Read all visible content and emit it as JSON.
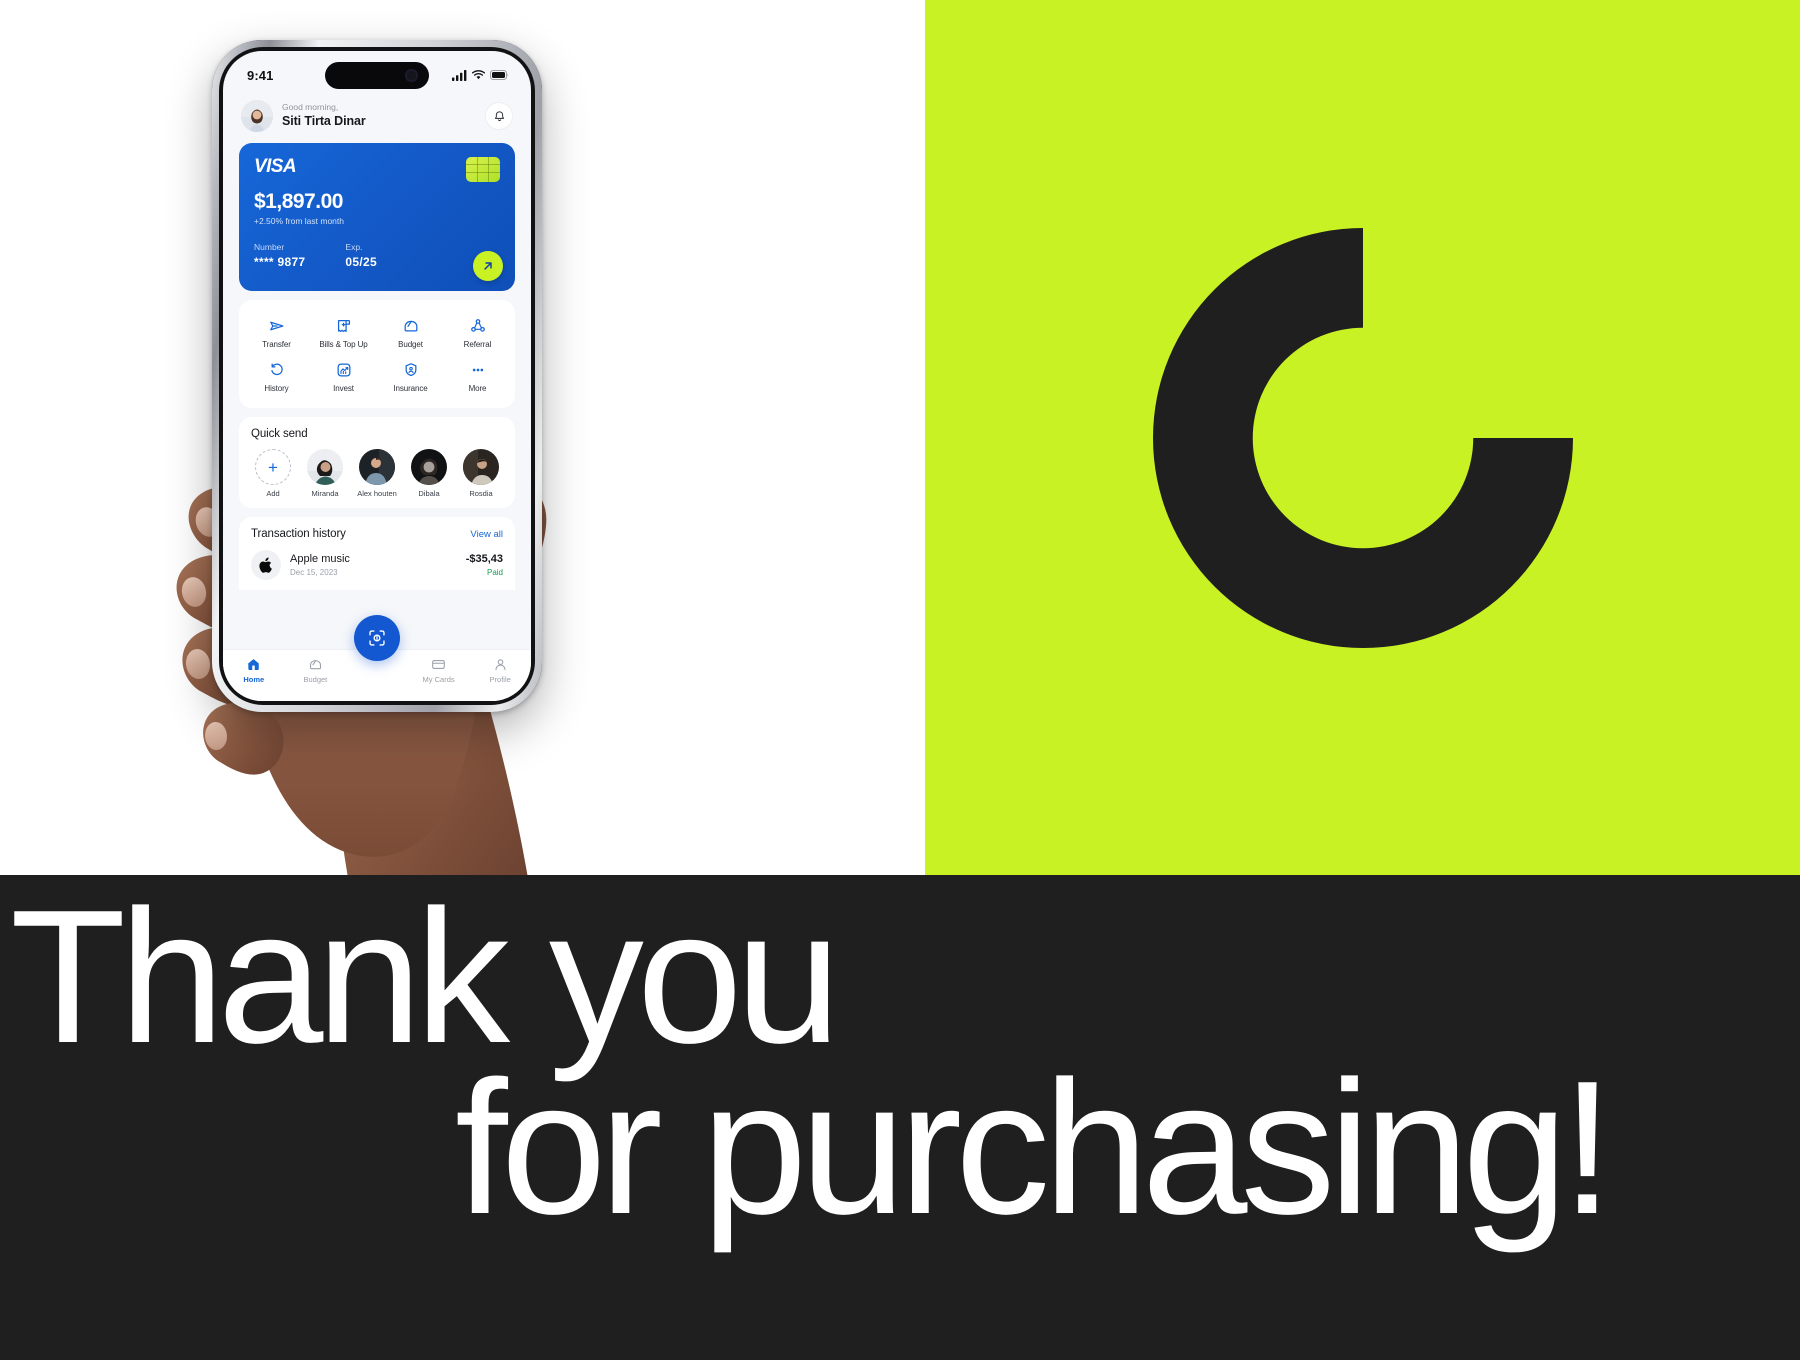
{
  "panels": {
    "left_bg": "#ffffff",
    "right_bg": "#c9f225",
    "band_bg": "#1f1f1f",
    "logo_color": "#1f1f1f",
    "logo_name": "circle-wedge-logo"
  },
  "band": {
    "line1": "Thank you",
    "line2": "for purchasing!"
  },
  "phone": {
    "statusbar": {
      "time": "9:41",
      "cellular_icon": "signal-bars-icon",
      "wifi_icon": "wifi-icon",
      "battery_icon": "battery-full-icon"
    },
    "header": {
      "greeting": "Good morning,",
      "user_name": "Siti Tirta Dinar",
      "avatar_name": "user-avatar",
      "bell_icon": "notification-bell-icon"
    },
    "card": {
      "brand": "VISA",
      "balance": "$1,897.00",
      "delta": "+2.50% from last month",
      "number_label": "Number",
      "number_value": "**** 9877",
      "exp_label": "Exp.",
      "exp_value": "05/25",
      "fab_icon": "arrow-up-right-icon",
      "chip_icon": "card-chip-icon",
      "bg_color": "#1358c6",
      "fab_color": "#c9f225"
    },
    "menu": [
      {
        "label": "Transfer",
        "icon": "send-paper-plane-icon"
      },
      {
        "label": "Bills & Top Up",
        "icon": "receipt-plus-icon"
      },
      {
        "label": "Budget",
        "icon": "wallet-icon"
      },
      {
        "label": "Referral",
        "icon": "people-network-icon"
      },
      {
        "label": "History",
        "icon": "clock-rotate-icon"
      },
      {
        "label": "Invest",
        "icon": "chart-growth-icon"
      },
      {
        "label": "Insurance",
        "icon": "shield-person-icon"
      },
      {
        "label": "More",
        "icon": "ellipsis-icon"
      }
    ],
    "quick_send": {
      "title": "Quick send",
      "contacts": [
        {
          "name": "Add",
          "type": "add-button"
        },
        {
          "name": "Miranda",
          "type": "contact-avatar"
        },
        {
          "name": "Alex houten",
          "type": "contact-avatar"
        },
        {
          "name": "Dibala",
          "type": "contact-avatar"
        },
        {
          "name": "Rosdia",
          "type": "contact-avatar"
        }
      ]
    },
    "transactions": {
      "title": "Transaction history",
      "view_all": "View all",
      "rows": [
        {
          "icon": "apple-logo-icon",
          "name": "Apple music",
          "date": "Dec 15, 2023",
          "amount": "-$35,43",
          "status": "Paid",
          "status_color": "#12a150"
        }
      ]
    },
    "tabbar": {
      "scan_icon": "qr-scan-icon",
      "items": [
        {
          "label": "Home",
          "icon": "home-icon",
          "active": true
        },
        {
          "label": "Budget",
          "icon": "wallet-icon",
          "active": false
        },
        {
          "label": "My Cards",
          "icon": "card-icon",
          "active": false
        },
        {
          "label": "Profile",
          "icon": "person-icon",
          "active": false
        }
      ]
    }
  }
}
